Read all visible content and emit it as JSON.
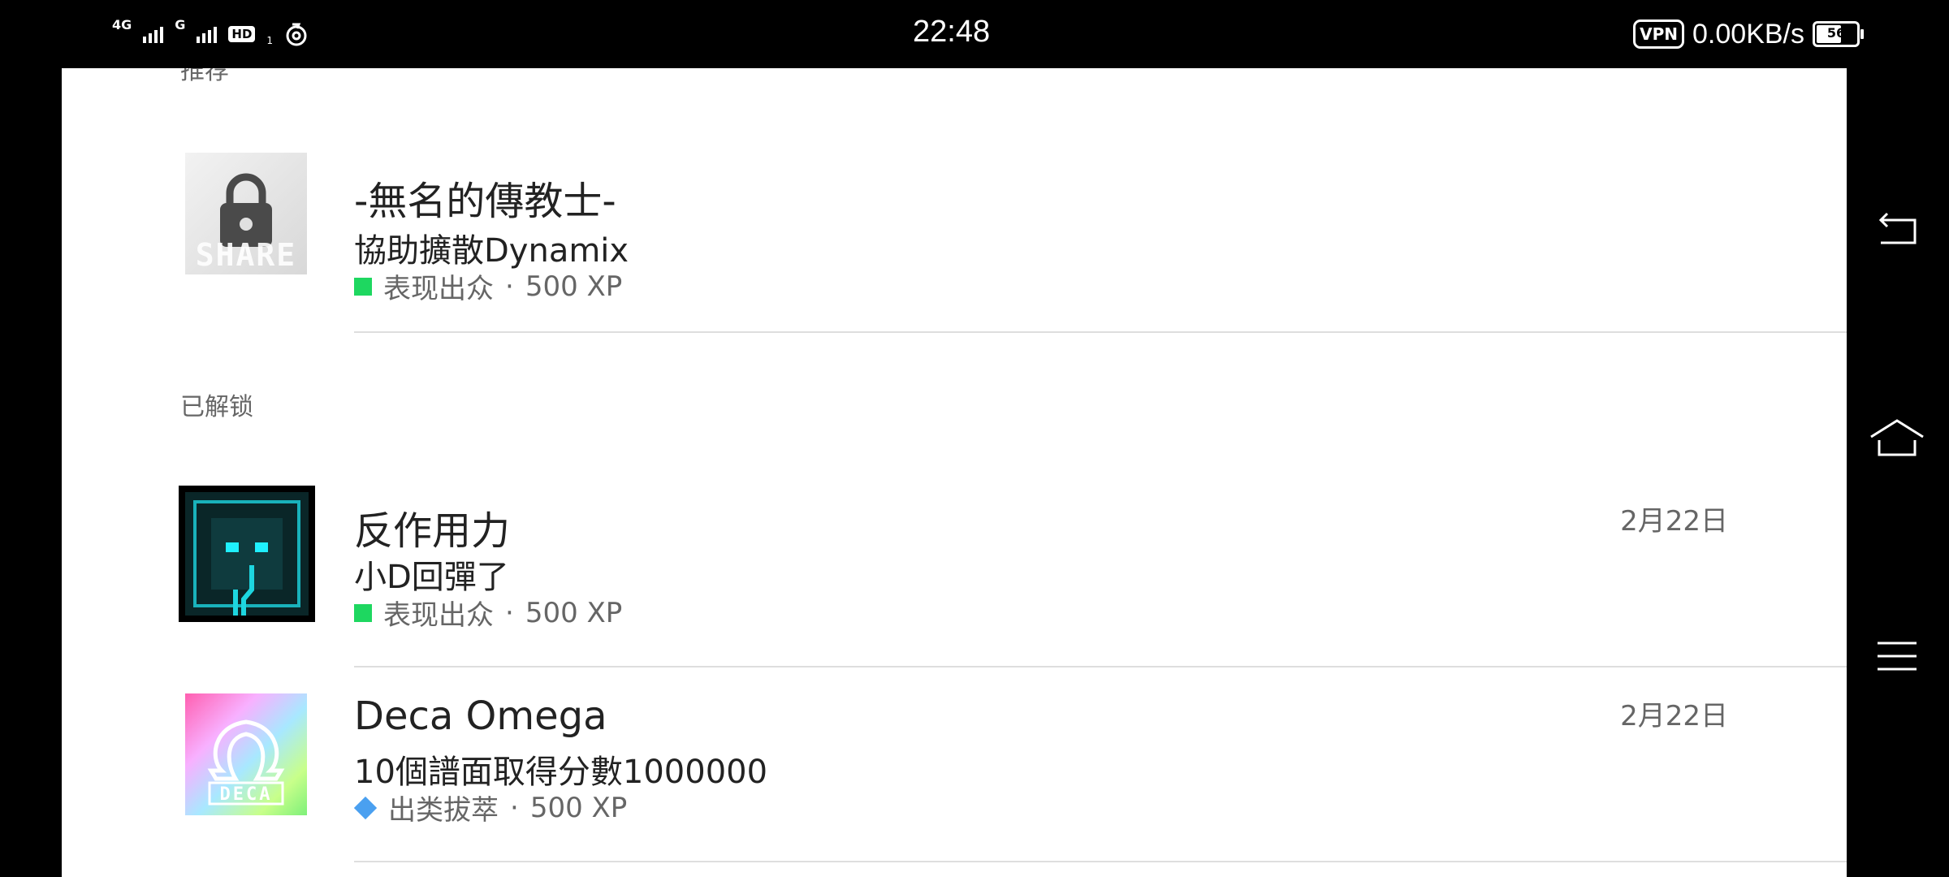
{
  "status_bar": {
    "network_1": "4G",
    "network_2": "G",
    "hd_label": "HD",
    "hd_sub": "1",
    "time": "22:48",
    "vpn_label": "VPN",
    "speed": "0.00KB/s",
    "battery": "56"
  },
  "sections": {
    "recommended": "推荐",
    "unlocked": "已解锁"
  },
  "achievements": [
    {
      "title": "-無名的傳教士-",
      "desc": "協助擴散Dynamix",
      "tier": "表现出众",
      "xp": "500 XP",
      "date": "",
      "thumb_text": "SHARE",
      "tier_icon": "green-square",
      "tier_color": "#1ed760"
    },
    {
      "title": "反作用力",
      "desc": "小D回彈了",
      "tier": "表现出众",
      "xp": "500 XP",
      "date": "2月22日",
      "thumb_text": "",
      "tier_icon": "green-square",
      "tier_color": "#1ed760"
    },
    {
      "title": "Deca Omega",
      "desc": "10個譜面取得分數1000000",
      "tier": "出类拔萃",
      "xp": "500 XP",
      "date": "2月22日",
      "thumb_text": "DECA",
      "tier_icon": "blue-diamond",
      "tier_color": "#4aa0f0"
    }
  ],
  "meta_separator": "·",
  "icons": [
    "lock-icon",
    "back-icon",
    "home-icon",
    "menu-icon",
    "cellular-icon",
    "hotspot-icon",
    "battery-icon"
  ]
}
